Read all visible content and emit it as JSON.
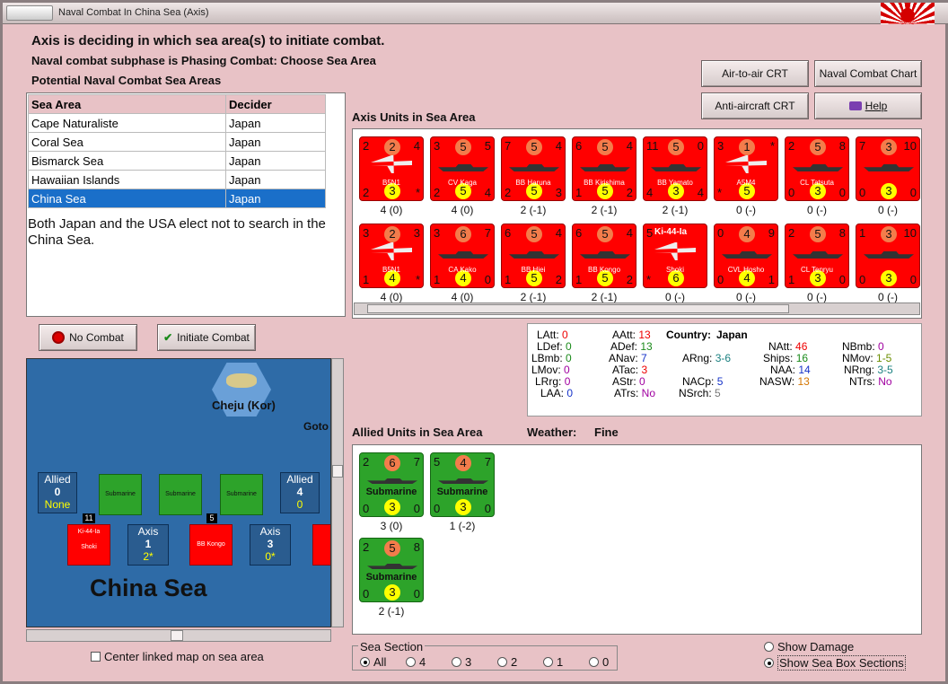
{
  "window": {
    "title": "Naval Combat In China Sea (Axis)"
  },
  "status": {
    "line1": "Axis is deciding in which sea area(s) to initiate combat.",
    "line2": "Naval combat subphase is Phasing Combat: Choose Sea Area",
    "line3": "Potential Naval Combat Sea Areas"
  },
  "buttons": {
    "air_to_air": "Air-to-air CRT",
    "naval_chart": "Naval Combat Chart",
    "anti_aircraft": "Anti-aircraft CRT",
    "help": "Help",
    "no_combat": "No Combat",
    "initiate_combat": "Initiate Combat"
  },
  "sea_table": {
    "headers": [
      "Sea Area",
      "Decider"
    ],
    "rows": [
      [
        "Cape Naturaliste",
        "Japan"
      ],
      [
        "Coral Sea",
        "Japan"
      ],
      [
        "Bismarck Sea",
        "Japan"
      ],
      [
        "Hawaiian Islands",
        "Japan"
      ],
      [
        "China Sea",
        "Japan"
      ]
    ],
    "selected_index": 4
  },
  "message": "Both Japan and the USA elect not to search in the China Sea.",
  "axis_units": {
    "title": "Axis Units in Sea Area",
    "units": [
      {
        "tl": "2",
        "tc": "2",
        "tr": "4",
        "bl": "2",
        "bc": "3",
        "br": "*",
        "name": "B5N1",
        "kind": "plane",
        "cap": "4 (0)"
      },
      {
        "tl": "3",
        "tc": "5",
        "tr": "5",
        "bl": "2",
        "bc": "5",
        "br": "4",
        "name": "CV Kaga",
        "kind": "ship",
        "cap": "4 (0)"
      },
      {
        "tl": "7",
        "tc": "5",
        "tr": "4",
        "bl": "2",
        "bc": "5",
        "br": "3",
        "name": "BB Haruna",
        "kind": "ship",
        "cap": "2 (-1)"
      },
      {
        "tl": "6",
        "tc": "5",
        "tr": "4",
        "bl": "1",
        "bc": "5",
        "br": "2",
        "name": "BB Kirishima",
        "kind": "ship",
        "cap": "2 (-1)"
      },
      {
        "tl": "11",
        "tc": "5",
        "tr": "0",
        "bl": "4",
        "bc": "3",
        "br": "4",
        "name": "BB Yamato",
        "kind": "ship",
        "cap": "2 (-1)"
      },
      {
        "tl": "3",
        "tc": "1",
        "tr": "*",
        "bl": "*",
        "bc": "5",
        "br": "",
        "name": "A5M4",
        "kind": "plane",
        "cap": "0 (-)"
      },
      {
        "tl": "2",
        "tc": "5",
        "tr": "8",
        "bl": "0",
        "bc": "3",
        "br": "0",
        "name": "CL Tatsuta",
        "kind": "ship",
        "cap": "0 (-)"
      },
      {
        "tl": "7",
        "tc": "3",
        "tr": "10",
        "bl": "0",
        "bc": "3",
        "br": "0",
        "name": "",
        "kind": "ship",
        "cap": "0 (-)"
      },
      {
        "tl": "3",
        "tc": "2",
        "tr": "3",
        "bl": "1",
        "bc": "4",
        "br": "*",
        "name": "B5N1",
        "kind": "plane",
        "cap": "4 (0)"
      },
      {
        "tl": "3",
        "tc": "6",
        "tr": "7",
        "bl": "1",
        "bc": "4",
        "br": "0",
        "name": "CA Kako",
        "kind": "ship",
        "cap": "4 (0)"
      },
      {
        "tl": "6",
        "tc": "5",
        "tr": "4",
        "bl": "1",
        "bc": "5",
        "br": "2",
        "name": "BB Hiei",
        "kind": "ship",
        "cap": "2 (-1)"
      },
      {
        "tl": "6",
        "tc": "5",
        "tr": "4",
        "bl": "1",
        "bc": "5",
        "br": "2",
        "name": "BB Kongo",
        "kind": "ship",
        "cap": "2 (-1)"
      },
      {
        "tl": "5",
        "tc": "Ki-44-Ia",
        "tr": "",
        "bl": "*",
        "bc": "6",
        "br": "",
        "name": "Shoki",
        "kind": "plane",
        "cap": "0 (-)"
      },
      {
        "tl": "0",
        "tc": "4",
        "tr": "9",
        "bl": "0",
        "bc": "4",
        "br": "1",
        "name": "CVL Hosho",
        "kind": "ship",
        "cap": "0 (-)"
      },
      {
        "tl": "2",
        "tc": "5",
        "tr": "8",
        "bl": "1",
        "bc": "3",
        "br": "0",
        "name": "CL Tenryu",
        "kind": "ship",
        "cap": "0 (-)"
      },
      {
        "tl": "1",
        "tc": "3",
        "tr": "10",
        "bl": "0",
        "bc": "3",
        "br": "0",
        "name": "",
        "kind": "ship",
        "cap": "0 (-)"
      }
    ]
  },
  "stats": {
    "LAtt": "0",
    "LDef": "0",
    "LBmb": "0",
    "LMov": "0",
    "LRrg": "0",
    "LAA": "0",
    "AAtt": "13",
    "ADef": "13",
    "ANav": "7",
    "ATac": "3",
    "AStr": "0",
    "ATrs": "No",
    "country_label": "Country:",
    "country": "Japan",
    "ARng": "3-6",
    "NACp": "5",
    "NSrch": "5",
    "NAtt": "46",
    "Ships": "16",
    "NAA": "14",
    "NASW": "13",
    "NBmb": "0",
    "NMov": "1-5",
    "NRng": "3-5",
    "NTrs": "No"
  },
  "allied_units": {
    "title": "Allied Units in Sea Area",
    "weather_label": "Weather:",
    "weather": "Fine",
    "units": [
      {
        "tl": "2",
        "tc": "6",
        "tr": "7",
        "bl": "0",
        "bc": "3",
        "br": "0",
        "name": "Submarine",
        "cap": "3 (0)"
      },
      {
        "tl": "5",
        "tc": "4",
        "tr": "7",
        "bl": "0",
        "bc": "3",
        "br": "0",
        "name": "Submarine",
        "cap": "1 (-2)"
      },
      {
        "tl": "2",
        "tc": "5",
        "tr": "8",
        "bl": "0",
        "bc": "3",
        "br": "0",
        "name": "Submarine",
        "cap": "2 (-1)"
      }
    ]
  },
  "map": {
    "island": "Cheju (Kor)",
    "goto": "Goto",
    "sea_name": "China Sea",
    "allied_left": {
      "label": "Allied",
      "value": "0",
      "sub": "None"
    },
    "allied_right": {
      "label": "Allied",
      "value": "4",
      "sub": "0"
    },
    "axis_1": {
      "label": "Axis",
      "value": "1",
      "sub": "2*"
    },
    "axis_3": {
      "label": "Axis",
      "value": "3",
      "sub": "0*"
    },
    "stack_1": "11",
    "stack_2": "5",
    "sub_name": "Submarine",
    "shoki": "Shoki",
    "bb_kongo": "BB Kongo",
    "ki": "Ki-44-Ia"
  },
  "center_checkbox": "Center linked map on sea area",
  "sea_section": {
    "label": "Sea Section",
    "options": [
      "All",
      "4",
      "3",
      "2",
      "1",
      "0"
    ],
    "selected": "All"
  },
  "show_damage": "Show Damage",
  "show_sections": "Show Sea Box Sections"
}
